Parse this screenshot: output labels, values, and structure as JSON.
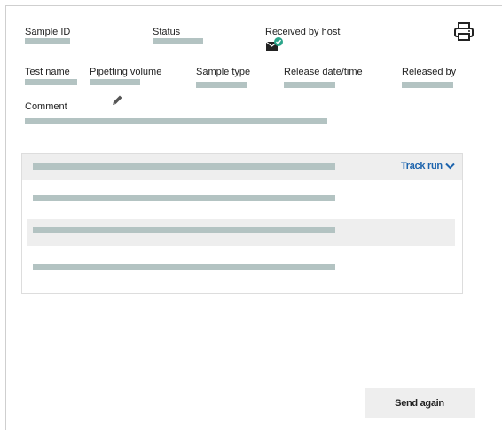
{
  "header": {
    "sample_id_label": "Sample ID",
    "status_label": "Status",
    "received_by_host_label": "Received by host",
    "print_icon": "printer-icon",
    "host_status_icon": "envelope-check-icon"
  },
  "details": {
    "test_name_label": "Test name",
    "pipetting_volume_label": "Pipetting volume",
    "sample_type_label": "Sample type",
    "release_label": "Release date/time",
    "released_by_label": "Released by",
    "comment_label": "Comment",
    "edit_icon": "pencil-icon"
  },
  "panel": {
    "track_run_label": "Track run",
    "track_run_icon": "chevron-down-icon"
  },
  "footer": {
    "send_again_label": "Send again"
  },
  "colors": {
    "placeholder_bar": "#b3c3c2",
    "accent": "#1d64ad",
    "panel_header": "#eeeeee",
    "host_icon_check": "#2aa58a"
  }
}
